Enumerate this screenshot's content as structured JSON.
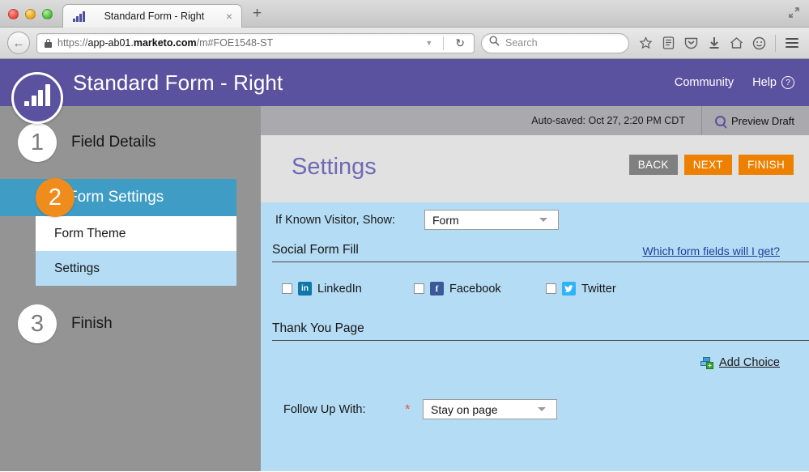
{
  "browser": {
    "tab": {
      "title": "Standard Form - Right",
      "close": "×",
      "favicon": "bar-chart-favicon"
    },
    "newtab_label": "+",
    "url": {
      "scheme": "https://",
      "host_pre": "app-ab01.",
      "host_bold": "marketo.com",
      "path": "/m#FOE1548-ST"
    },
    "search_placeholder": "Search",
    "reload_glyph": "↻",
    "back_glyph": "←",
    "icons": [
      "bookmark-star-icon",
      "reader-list-icon",
      "pocket-icon",
      "downloads-icon",
      "home-icon",
      "sync-smiley-icon",
      "hamburger-menu-icon"
    ]
  },
  "header": {
    "app_title": "Standard Form - Right",
    "community_label": "Community",
    "help_label": "Help",
    "help_glyph": "?",
    "brand_color": "#5b529f"
  },
  "subbar": {
    "autosave_text": "Auto-saved: Oct 27, 2:20 PM CDT",
    "preview_label": "Preview Draft"
  },
  "sidebar": {
    "steps": [
      {
        "number": "1",
        "label": "Field Details",
        "active": false
      },
      {
        "number": "2",
        "label": "Form Settings",
        "active": true
      },
      {
        "number": "3",
        "label": "Finish",
        "active": false
      }
    ],
    "submenu": [
      {
        "label": "Form Theme",
        "selected": false
      },
      {
        "label": "Settings",
        "selected": true
      }
    ]
  },
  "main": {
    "page_title": "Settings",
    "buttons": {
      "back": "BACK",
      "next": "NEXT",
      "finish": "FINISH"
    },
    "known_visitor": {
      "label": "If Known Visitor, Show:",
      "value": "Form"
    },
    "social": {
      "title": "Social Form Fill",
      "link": "Which form fields will I get?",
      "options": [
        {
          "label": "LinkedIn",
          "glyph": "in",
          "checked": false,
          "color": "#0e76a8"
        },
        {
          "label": "Facebook",
          "glyph": "f",
          "checked": false,
          "color": "#3b5998"
        },
        {
          "label": "Twitter",
          "glyph": "✉",
          "checked": false,
          "color": "#2fb3f6"
        }
      ]
    },
    "thank_you": {
      "title": "Thank You Page",
      "add_choice_label": "Add Choice",
      "follow_up": {
        "label": "Follow Up With:",
        "required": "*",
        "value": "Stay on page"
      }
    }
  }
}
